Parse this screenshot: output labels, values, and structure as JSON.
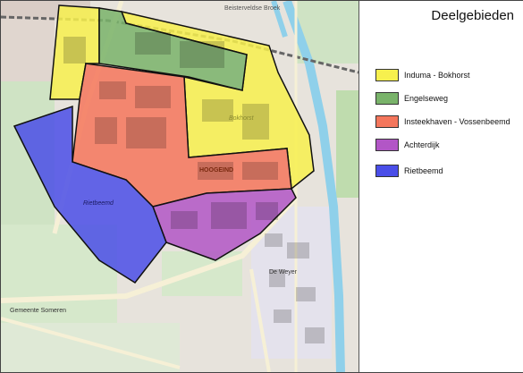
{
  "title": "Deelgebieden",
  "legend": [
    {
      "label": "Induma - Bokhorst",
      "color": "#f7f04e"
    },
    {
      "label": "Engelseweg",
      "color": "#79b36a"
    },
    {
      "label": "Insteekhaven - Vossenbeemd",
      "color": "#f4765c"
    },
    {
      "label": "Achterdijk",
      "color": "#b256c6"
    },
    {
      "label": "Rietbeemd",
      "color": "#4a4ee8"
    }
  ],
  "map_labels": {
    "street_north": "Beisterveldse Broek",
    "hoogeind": "HOOGEIND",
    "bokhorst": "Bokhorst",
    "rietbeemd": "Rietbeemd",
    "de_weyer": "De Weyer",
    "gemeente": "Gemeente Someren"
  }
}
